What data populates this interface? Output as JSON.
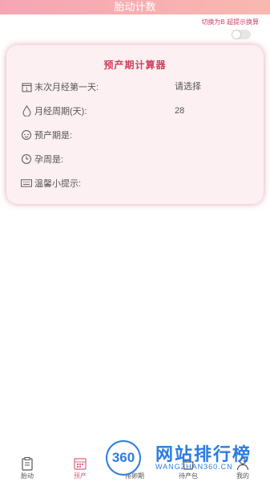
{
  "header": {
    "title": "胎动计数"
  },
  "toggle": {
    "label": "切换为B 超提示换算",
    "on": false
  },
  "card": {
    "title": "预产期计算器",
    "rows": [
      {
        "icon": "calendar-icon",
        "label": "末次月经第一天:",
        "value": "请选择"
      },
      {
        "icon": "drop-icon",
        "label": "月经周期(天):",
        "value": "28"
      },
      {
        "icon": "baby-face-icon",
        "label": "预产期是:",
        "value": ""
      },
      {
        "icon": "clock-icon",
        "label": "孕周是:",
        "value": ""
      },
      {
        "icon": "keyboard-icon",
        "label": "温馨小提示:",
        "value": ""
      }
    ]
  },
  "tabbar": {
    "tabs": [
      {
        "icon": "clipboard-icon",
        "label": "胎动",
        "active": false
      },
      {
        "icon": "calendar-icon",
        "label": "预产",
        "active": true
      },
      {
        "icon": "wand-icon",
        "label": "排卵期",
        "active": false
      },
      {
        "icon": "bag-icon",
        "label": "待产包",
        "active": false
      },
      {
        "icon": "person-icon",
        "label": "我的",
        "active": false
      }
    ]
  },
  "watermark": {
    "badge": "360",
    "text": "网站排行榜",
    "sub": "WANGZHAN360.CN"
  },
  "colors": {
    "accent": "#e06080",
    "header": "#f6a5b4",
    "card_bg": "#fdf0f2",
    "watermark": "#2c7be0"
  }
}
